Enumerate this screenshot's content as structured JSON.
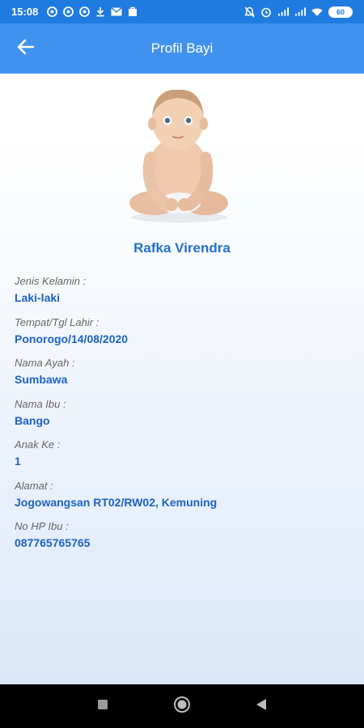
{
  "status_bar": {
    "time": "15:08",
    "battery": "60"
  },
  "app_bar": {
    "title": "Profil Bayi"
  },
  "profile": {
    "name": "Rafka Virendra",
    "fields": [
      {
        "label": "Jenis Kelamin :",
        "value": "Laki-laki"
      },
      {
        "label": "Tempat/Tgl Lahir :",
        "value": "Ponorogo/14/08/2020"
      },
      {
        "label": "Nama Ayah :",
        "value": "Sumbawa"
      },
      {
        "label": "Nama Ibu :",
        "value": "Bango"
      },
      {
        "label": "Anak Ke :",
        "value": "1"
      },
      {
        "label": "Alamat :",
        "value": "Jogowangsan RT02/RW02, Kemuning"
      },
      {
        "label": "No HP Ibu :",
        "value": "087765765765"
      }
    ]
  },
  "colors": {
    "status_bar": "#1f7be0",
    "app_bar": "#4192ef",
    "accent_text": "#1b63c4"
  }
}
